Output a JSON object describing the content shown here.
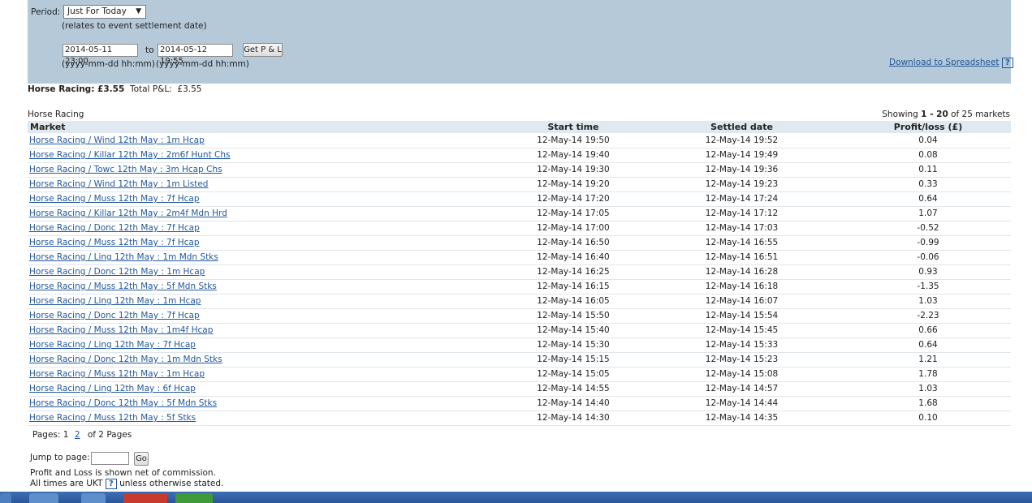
{
  "filter": {
    "period_label": "Period:",
    "period_value": "Just For Today",
    "period_note": "(relates to event settlement date)",
    "from_value": "2014-05-11 23:00",
    "to_label": "to",
    "to_value": "2014-05-12 19:55",
    "get_pl_label": "Get P & L",
    "from_format": "(yyyy-mm-dd hh:mm)",
    "to_format": "(yyyy-mm-dd hh:mm)",
    "download_label": "Download to Spreadsheet",
    "help_icon": "?"
  },
  "summary": {
    "sport_total": "Horse Racing: £3.55",
    "total_label": "Total P&L:",
    "total_value": "£3.55"
  },
  "table": {
    "section_title": "Horse Racing",
    "showing_prefix": "Showing ",
    "showing_range": "1 - 20",
    "showing_suffix": " of 25 markets",
    "headers": [
      "Market",
      "Start time",
      "Settled date",
      "Profit/loss (£)"
    ],
    "rows": [
      {
        "market": "Horse Racing / Wind 12th May : 1m Hcap",
        "start": "12-May-14 19:50",
        "settled": "12-May-14 19:52",
        "pl": "0.04"
      },
      {
        "market": "Horse Racing / Killar 12th May : 2m6f Hunt Chs",
        "start": "12-May-14 19:40",
        "settled": "12-May-14 19:49",
        "pl": "0.08"
      },
      {
        "market": "Horse Racing / Towc 12th May : 3m Hcap Chs",
        "start": "12-May-14 19:30",
        "settled": "12-May-14 19:36",
        "pl": "0.11"
      },
      {
        "market": "Horse Racing / Wind 12th May : 1m Listed",
        "start": "12-May-14 19:20",
        "settled": "12-May-14 19:23",
        "pl": "0.33"
      },
      {
        "market": "Horse Racing / Muss 12th May : 7f Hcap",
        "start": "12-May-14 17:20",
        "settled": "12-May-14 17:24",
        "pl": "0.64"
      },
      {
        "market": "Horse Racing / Killar 12th May : 2m4f Mdn Hrd",
        "start": "12-May-14 17:05",
        "settled": "12-May-14 17:12",
        "pl": "1.07"
      },
      {
        "market": "Horse Racing / Donc 12th May : 7f Hcap",
        "start": "12-May-14 17:00",
        "settled": "12-May-14 17:03",
        "pl": "-0.52"
      },
      {
        "market": "Horse Racing / Muss 12th May : 7f Hcap",
        "start": "12-May-14 16:50",
        "settled": "12-May-14 16:55",
        "pl": "-0.99"
      },
      {
        "market": "Horse Racing / Ling 12th May : 1m Mdn Stks",
        "start": "12-May-14 16:40",
        "settled": "12-May-14 16:51",
        "pl": "-0.06"
      },
      {
        "market": "Horse Racing / Donc 12th May : 1m Hcap",
        "start": "12-May-14 16:25",
        "settled": "12-May-14 16:28",
        "pl": "0.93"
      },
      {
        "market": "Horse Racing / Muss 12th May : 5f Mdn Stks",
        "start": "12-May-14 16:15",
        "settled": "12-May-14 16:18",
        "pl": "-1.35"
      },
      {
        "market": "Horse Racing / Ling 12th May : 1m Hcap",
        "start": "12-May-14 16:05",
        "settled": "12-May-14 16:07",
        "pl": "1.03"
      },
      {
        "market": "Horse Racing / Donc 12th May : 7f Hcap",
        "start": "12-May-14 15:50",
        "settled": "12-May-14 15:54",
        "pl": "-2.23"
      },
      {
        "market": "Horse Racing / Muss 12th May : 1m4f Hcap",
        "start": "12-May-14 15:40",
        "settled": "12-May-14 15:45",
        "pl": "0.66"
      },
      {
        "market": "Horse Racing / Ling 12th May : 7f Hcap",
        "start": "12-May-14 15:30",
        "settled": "12-May-14 15:33",
        "pl": "0.64"
      },
      {
        "market": "Horse Racing / Donc 12th May : 1m Mdn Stks",
        "start": "12-May-14 15:15",
        "settled": "12-May-14 15:23",
        "pl": "1.21"
      },
      {
        "market": "Horse Racing / Muss 12th May : 1m Hcap",
        "start": "12-May-14 15:05",
        "settled": "12-May-14 15:08",
        "pl": "1.78"
      },
      {
        "market": "Horse Racing / Ling 12th May : 6f Hcap",
        "start": "12-May-14 14:55",
        "settled": "12-May-14 14:57",
        "pl": "1.03"
      },
      {
        "market": "Horse Racing / Donc 12th May : 5f Mdn Stks",
        "start": "12-May-14 14:40",
        "settled": "12-May-14 14:44",
        "pl": "1.68"
      },
      {
        "market": "Horse Racing / Muss 12th May : 5f Stks",
        "start": "12-May-14 14:30",
        "settled": "12-May-14 14:35",
        "pl": "0.10"
      }
    ]
  },
  "pagination": {
    "pages_label": "Pages:",
    "page1": "1",
    "page2": "2",
    "of_pages": "of 2 Pages",
    "jump_label": "Jump to page:",
    "go_label": "Go"
  },
  "notes": {
    "commission": "Profit and Loss is shown net of commission.",
    "times_prefix": "All times are UKT",
    "times_suffix": "unless otherwise stated."
  },
  "colors": {
    "panel_bg": "#b5c9d8",
    "header_bg": "#dfe9ef",
    "link": "#23589a",
    "taskbar": "#2a559b"
  }
}
